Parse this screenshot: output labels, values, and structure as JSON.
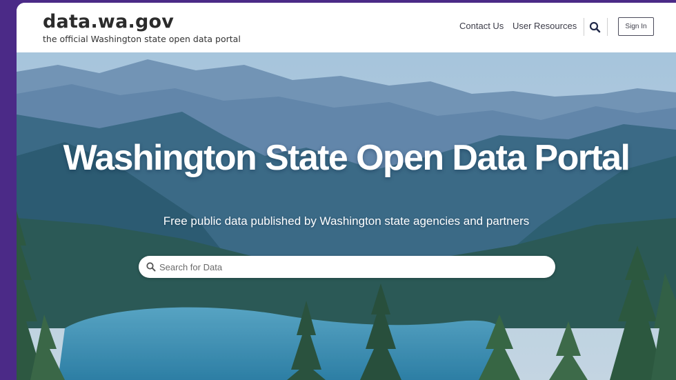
{
  "brand": {
    "title": "data.wa.gov",
    "subtitle": "the official Washington state open data portal"
  },
  "nav": {
    "contact": "Contact Us",
    "resources": "User Resources",
    "search_icon": "search-icon",
    "signin": "Sign In"
  },
  "hero": {
    "title": "Washington State Open Data Portal",
    "subtitle": "Free public data published by Washington state agencies and partners",
    "search_placeholder": "Search for Data",
    "search_value": ""
  },
  "colors": {
    "page_background": "#4b2a87",
    "header_background": "#ffffff",
    "text_dark": "#2b2b2b"
  }
}
